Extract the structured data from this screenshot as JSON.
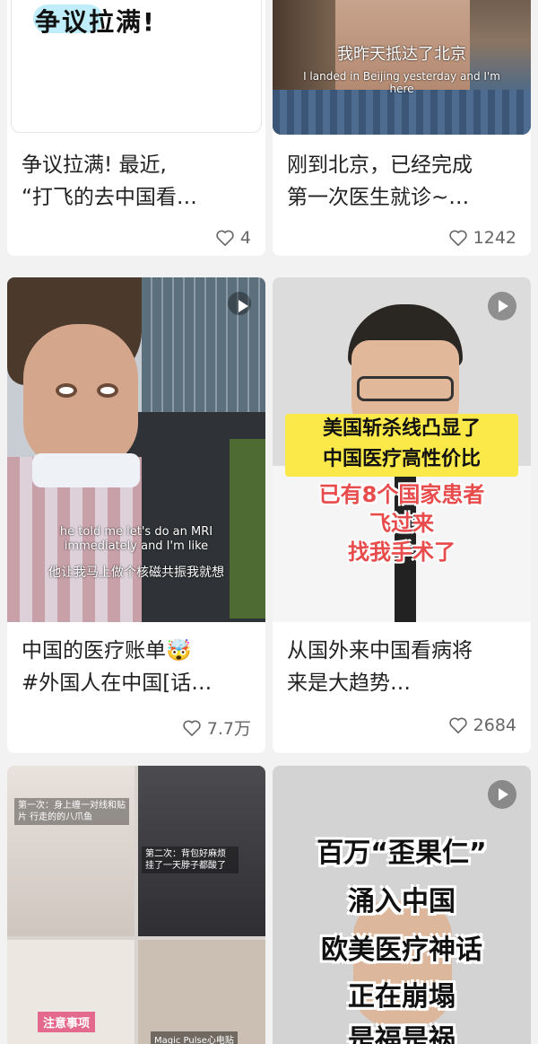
{
  "feed": {
    "accent": "#e2454f",
    "cards": [
      {
        "overlay_text": "争议拉满!",
        "title": "争议拉满! 最近,\n“打飞的去中国看…",
        "likes": "4"
      },
      {
        "subtitle_cn": "我昨天抵达了北京",
        "subtitle_en": "I landed in Beijing yesterday and I'm here",
        "title": "刚到北京，已经完成\n第一次医生就诊~…",
        "likes": "1242"
      },
      {
        "subtitle_en": "he told me let's do an MRI immediately and I'm like",
        "subtitle_cn": "他让我马上做个核磁共振我就想",
        "title": "中国的医疗账单🤯\n#外国人在中国[话…",
        "likes": "7.7万",
        "icon": "play-icon"
      },
      {
        "banner_line1": "美国斩杀线凸显了",
        "banner_line2": "中国医疗高性价比",
        "red_line1": "已有8个国家患者",
        "red_line2": "飞过来",
        "red_line3": "找我手术了",
        "title": "从国外来中国看病将\n来是大趋势…",
        "likes": "2684",
        "icon": "play-icon"
      },
      {
        "caption1": "第一次：身上缠一对线和贴片 行走的的八爪鱼",
        "caption2": "第二次：背包好麻烦 挂了一天脖子都酸了",
        "caption3": "注意事项",
        "caption4": "Magic Pulse心电贴"
      },
      {
        "line1": "百万“歪果仁”",
        "line2": "涌入中国",
        "line3": "欧美医疗神话",
        "line4": "正在崩塌",
        "line5": "是福是祸",
        "icon": "play-icon"
      }
    ]
  }
}
